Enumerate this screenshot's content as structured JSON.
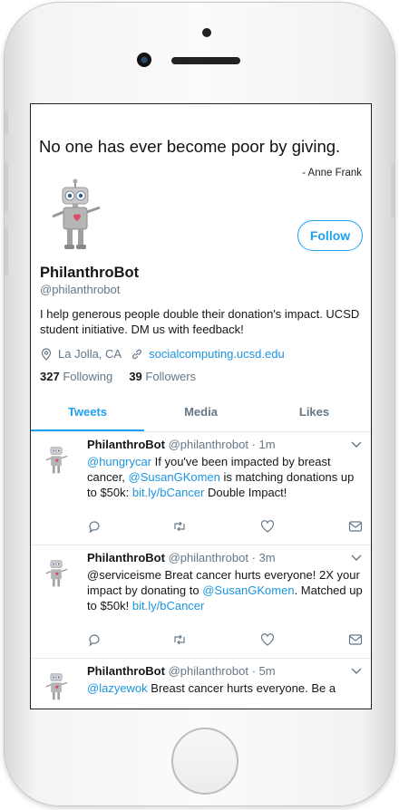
{
  "profile": {
    "quote": "No one has ever become poor by giving.",
    "quote_author": "- Anne Frank",
    "name": "PhilanthroBot",
    "handle": "@philanthrobot",
    "bio": "I help generous people double their donation's impact. UCSD student initiative. DM us with feedback!",
    "location": "La Jolla, CA",
    "website": "socialcomputing.ucsd.edu",
    "following_count": "327",
    "following_label": "Following",
    "followers_count": "39",
    "followers_label": "Followers",
    "follow_button": "Follow"
  },
  "tabs": [
    {
      "label": "Tweets",
      "active": true
    },
    {
      "label": "Media",
      "active": false
    },
    {
      "label": "Likes",
      "active": false
    }
  ],
  "tweets": [
    {
      "name": "PhilanthroBot",
      "handle": "@philanthrobot",
      "time": "· 1m",
      "mention": "@hungrycar",
      "text_a": " If you've been impacted by breast cancer, ",
      "link_a": "@SusanGKomen",
      "text_b": " is matching donations up to $50k: ",
      "link_b": "bit.ly/bCancer",
      "text_c": " Double Impact!"
    },
    {
      "name": "PhilanthroBot",
      "handle": "@philanthrobot",
      "time": "· 3m",
      "mention": "@serviceisme",
      "text_a": " Breat cancer hurts everyone! 2X your impact by donating to ",
      "link_a": "@SusanGKomen",
      "text_b": ". Matched up to $50k! ",
      "link_b": "bit.ly/bCancer",
      "text_c": ""
    },
    {
      "name": "PhilanthroBot",
      "handle": "@philanthrobot",
      "time": "· 5m",
      "mention": "@lazyewok",
      "text_a": " Breast cancer hurts everyone. Be a",
      "link_a": "",
      "text_b": "",
      "link_b": "",
      "text_c": ""
    }
  ],
  "colors": {
    "accent": "#1da1f2",
    "link": "#1b95e0",
    "muted": "#657786",
    "text": "#14171a",
    "divider": "#e1e8ed"
  },
  "icons": [
    "location-pin-icon",
    "link-icon",
    "reply-icon",
    "retweet-icon",
    "like-icon",
    "message-icon",
    "chevron-down-icon",
    "robot-avatar"
  ]
}
